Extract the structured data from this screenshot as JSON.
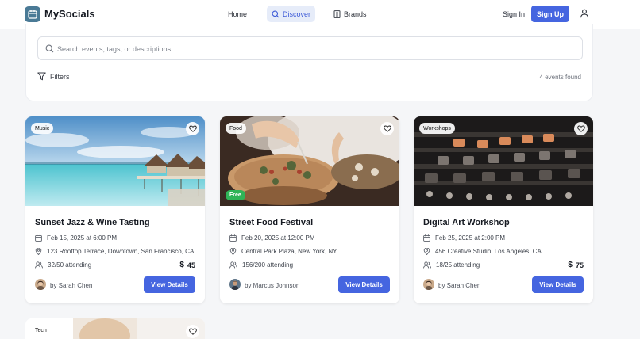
{
  "app": {
    "name": "MySocials"
  },
  "nav": {
    "home": "Home",
    "discover": "Discover",
    "brands": "Brands",
    "sign_in": "Sign In",
    "sign_up": "Sign Up"
  },
  "search": {
    "placeholder": "Search events, tags, or descriptions...",
    "value": "",
    "filters_label": "Filters",
    "results_count": "4 events found"
  },
  "events": [
    {
      "tag": "Music",
      "title": "Sunset Jazz & Wine Tasting",
      "date": "Feb 15, 2025 at 6:00 PM",
      "location": "123 Rooftop Terrace, Downtown, San Francisco, CA",
      "attending": "32/50 attending",
      "price": "45",
      "host": "by Sarah Chen",
      "button": "View Details"
    },
    {
      "tag": "Food",
      "badge": "Free",
      "title": "Street Food Festival",
      "date": "Feb 20, 2025 at 12:00 PM",
      "location": "Central Park Plaza, New York, NY",
      "attending": "156/200 attending",
      "host": "by Marcus Johnson",
      "button": "View Details"
    },
    {
      "tag": "Workshops",
      "title": "Digital Art Workshop",
      "date": "Feb 25, 2025 at 2:00 PM",
      "location": "456 Creative Studio, Los Angeles, CA",
      "attending": "18/25 attending",
      "price": "75",
      "host": "by Sarah Chen",
      "button": "View Details"
    },
    {
      "tag": "Tech"
    }
  ],
  "colors": {
    "accent": "#4565e0",
    "discover_bg": "#e6ecf9",
    "free_badge": "#2fb457",
    "logo": "#4a7a96"
  }
}
